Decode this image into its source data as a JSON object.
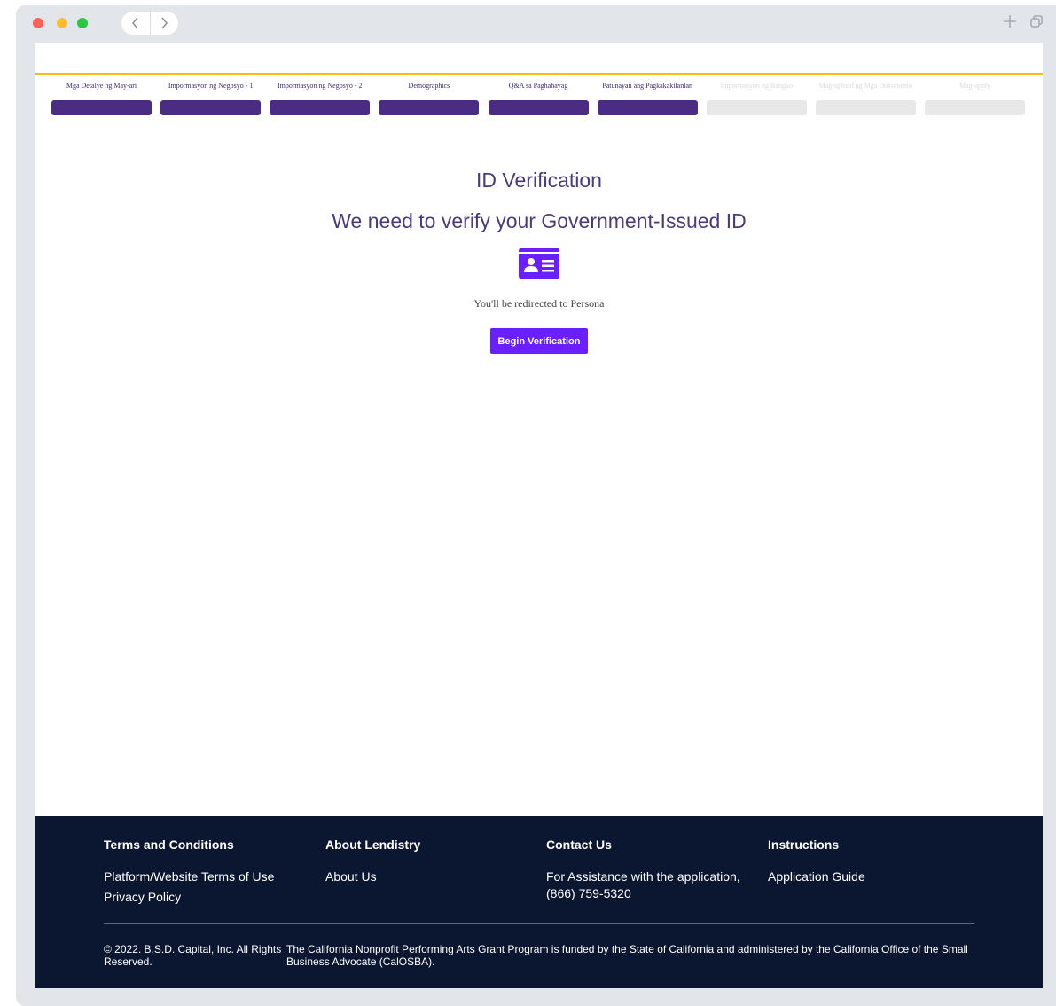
{
  "browser": {
    "back_icon": "chevron-left-icon",
    "forward_icon": "chevron-right-icon",
    "new_tab_icon": "plus-icon",
    "tabs_icon": "copy-icon"
  },
  "colors": {
    "accent_gold": "#f7b928",
    "step_done": "#4a2c84",
    "step_pending": "#e8e8e8",
    "primary_button": "#6a1fff",
    "footer_bg": "#0b1730"
  },
  "steps": [
    {
      "label": "Mga Detalye ng May-ari",
      "status": "done"
    },
    {
      "label": "Impormasyon ng Negosyo - 1",
      "status": "done"
    },
    {
      "label": "Impormasyon ng Negosyo - 2",
      "status": "done"
    },
    {
      "label": "Demographics",
      "status": "done"
    },
    {
      "label": "Q&A sa Paghahayag",
      "status": "done"
    },
    {
      "label": "Patunayan ang Pagkakakilanlan",
      "status": "done"
    },
    {
      "label": "Impormasyon ng Bangko",
      "status": "pending"
    },
    {
      "label": "Mag-upload ng Mga Dokumento",
      "status": "pending"
    },
    {
      "label": "Mag-apply",
      "status": "pending"
    }
  ],
  "main": {
    "title": "ID Verification",
    "subtitle": "We need to verify your Government-Issued ID",
    "icon": "id-card-icon",
    "redirect_text": "You'll be redirected to Persona",
    "begin_button": "Begin Verification"
  },
  "footer": {
    "terms_heading": "Terms and Conditions",
    "terms_link_1": "Platform/Website Terms of Use",
    "terms_link_2": "Privacy Policy",
    "about_heading": "About Lendistry",
    "about_link": "About Us",
    "contact_heading": "Contact Us",
    "contact_line_1": "For Assistance with the application,",
    "contact_phone": "(866) 759-5320",
    "instructions_heading": "Instructions",
    "instructions_link": "Application Guide",
    "copyright": "© 2022. B.S.D. Capital, Inc. All Rights Reserved.",
    "funding_note": "The California Nonprofit Performing Arts Grant Program is funded by the State of California and administered by the California Office of the Small Business Advocate (CalOSBA)."
  }
}
